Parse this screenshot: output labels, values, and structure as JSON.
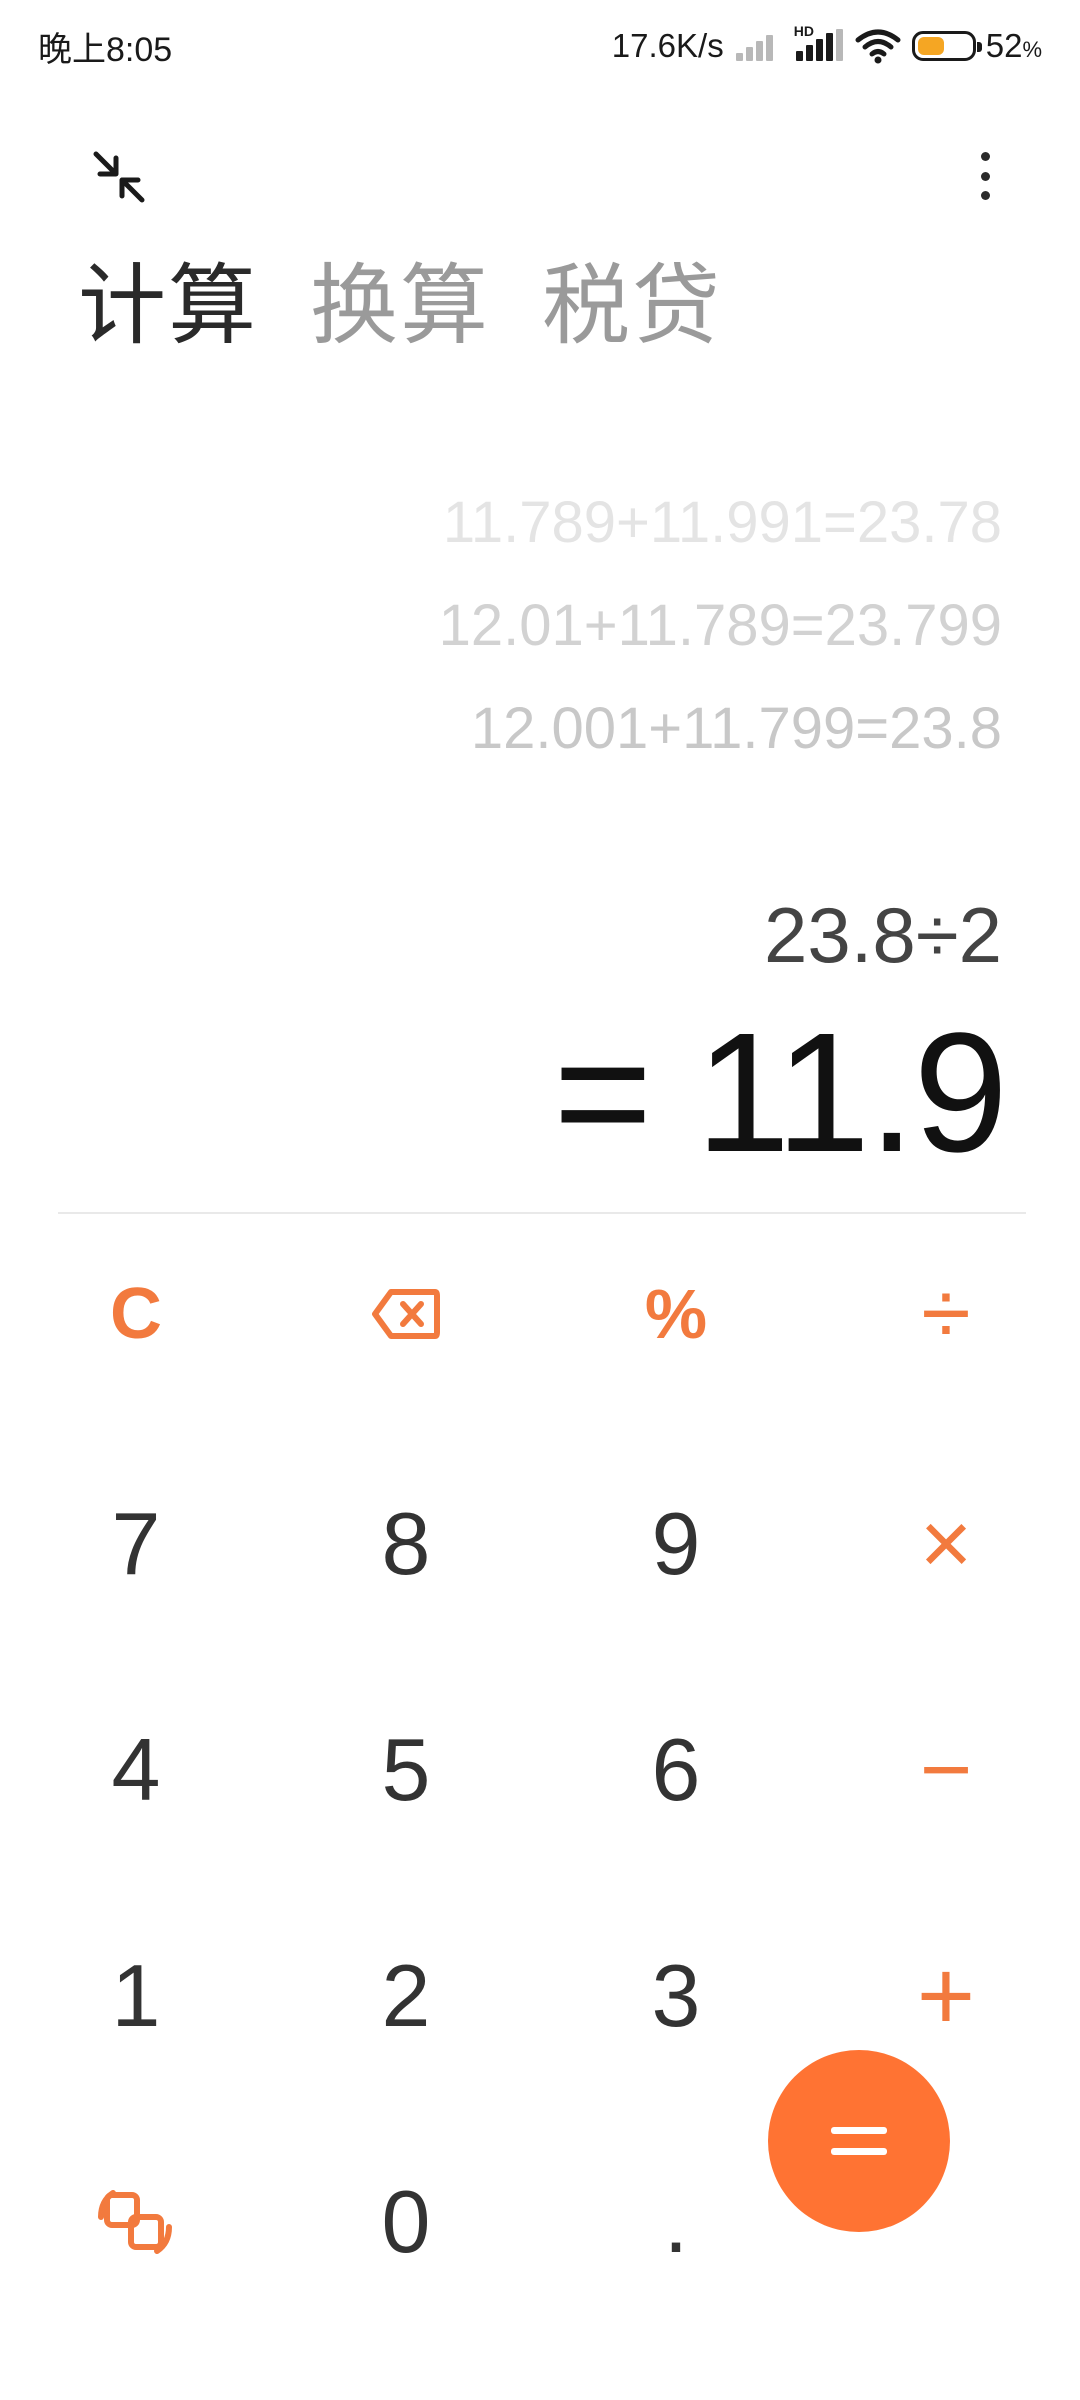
{
  "status": {
    "time": "晚上8:05",
    "net_speed": "17.6K/s",
    "hd_label": "HD",
    "battery_pct": "52",
    "battery_unit": "%",
    "battery_level": 0.52,
    "battery_color": "#f5a623"
  },
  "top": {
    "shrink_icon": "shrink-arrows-icon",
    "more_icon": "more-vertical-icon"
  },
  "tabs": [
    {
      "label": "计算",
      "active": true
    },
    {
      "label": "换算",
      "active": false
    },
    {
      "label": "税贷",
      "active": false
    }
  ],
  "history": [
    "11.789+11.991=23.78",
    "12.01+11.789=23.799",
    "12.001+11.799=23.8"
  ],
  "display": {
    "expression": "23.8÷2",
    "result": "= 11.9"
  },
  "keypad": {
    "clear": "C",
    "backspace_icon": "backspace-icon",
    "percent": "%",
    "divide": "÷",
    "multiply": "×",
    "minus": "−",
    "plus": "+",
    "digits": [
      "0",
      "1",
      "2",
      "3",
      "4",
      "5",
      "6",
      "7",
      "8",
      "9"
    ],
    "dot": ".",
    "switch_icon": "scientific-switch-icon",
    "equals": "="
  },
  "colors": {
    "accent": "#ff7333",
    "operator": "#f27a3e",
    "text": "#333333"
  }
}
